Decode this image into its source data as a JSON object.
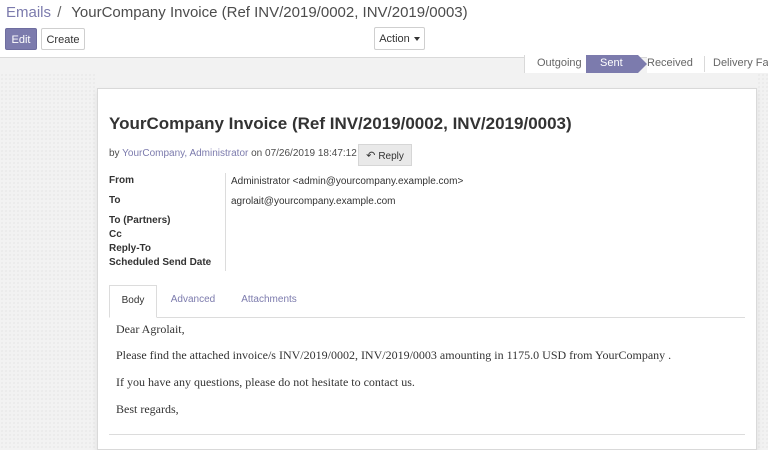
{
  "breadcrumb": {
    "parent": "Emails",
    "separator": "/",
    "current": "YourCompany Invoice (Ref INV/2019/0002, INV/2019/0003)"
  },
  "buttons": {
    "edit": "Edit",
    "create": "Create",
    "action": "Action"
  },
  "statusbar": {
    "stages": [
      "Outgoing",
      "Sent",
      "Received",
      "Delivery Failed"
    ],
    "active": "Sent",
    "accent": "#7c7bad"
  },
  "message": {
    "subject": "YourCompany Invoice (Ref INV/2019/0002, INV/2019/0003)",
    "by_prefix": "by",
    "author": "YourCompany, Administrator",
    "on_prefix": "on",
    "date": "07/26/2019 18:47:12",
    "reply_label": "Reply",
    "reply_icon": "reply-arrow-icon"
  },
  "fields": {
    "from_label": "From",
    "from_value": "Administrator <admin@yourcompany.example.com>",
    "to_label": "To",
    "to_value": "agrolait@yourcompany.example.com",
    "to_partners_label": "To (Partners)",
    "cc_label": "Cc",
    "reply_to_label": "Reply-To",
    "scheduled_label": "Scheduled Send Date"
  },
  "tabs": [
    {
      "label": "Body"
    },
    {
      "label": "Advanced"
    },
    {
      "label": "Attachments"
    }
  ],
  "body": {
    "greeting": "Dear Agrolait,",
    "line1": "Please find the attached invoice/s INV/2019/0002, INV/2019/0003 amounting in 1175.0 USD from YourCompany .",
    "line2": "If you have any questions, please do not hesitate to contact us.",
    "closing": "Best regards,"
  }
}
